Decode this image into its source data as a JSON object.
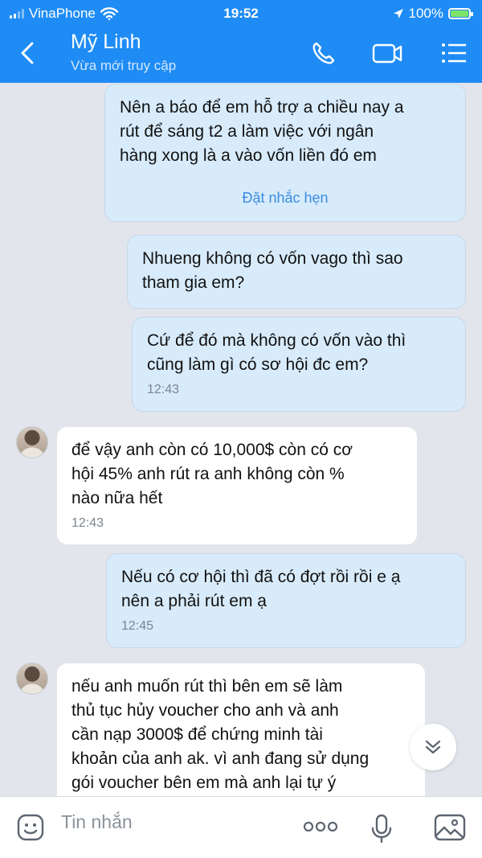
{
  "status_bar": {
    "carrier": "VinaPhone",
    "time": "19:52",
    "battery": "100%",
    "battery_level": 1.0
  },
  "header": {
    "contact_name": "Mỹ Linh",
    "contact_status": "Vừa mới truy cập"
  },
  "messages": [
    {
      "direction": "out",
      "text": "Nên a báo để em hỗ trợ a chiều nay a\nrút để sáng t2 a làm việc với ngân\nhàng xong là a vào vốn liền đó em",
      "action": "Đặt nhắc hẹn"
    },
    {
      "direction": "out",
      "text": "Nhueng không có vốn vago thì sao\ntham gia em?"
    },
    {
      "direction": "out",
      "text": "Cứ để đó mà không có vốn vào thì\ncũng làm gì có sơ hội đc em?",
      "time": "12:43"
    },
    {
      "direction": "in",
      "text": "để vậy anh còn có 10,000$ còn có cơ\nhội 45% anh rút ra anh không còn %\nnào nữa hết",
      "time": "12:43"
    },
    {
      "direction": "out",
      "text": "Nếu có cơ hội thì đã có đợt rồi rồi e ạ\nnên a phải rút em ạ",
      "time": "12:45"
    },
    {
      "direction": "in",
      "text": "nếu anh muốn rút thì bên em sẽ làm\nthủ tục hủy voucher cho anh và anh\ncần nạp 3000$ để chứng minh tài\nkhoản của anh ak. vì anh đang sử dụng\ngói voucher bên em mà anh lại tự ý"
    }
  ],
  "composer": {
    "placeholder": "Tin nhắn"
  },
  "colors": {
    "header": "#1f8cf5",
    "outgoing_bubble": "#d8ebfb",
    "incoming_bubble": "#ffffff",
    "background": "#e2e5ec"
  }
}
